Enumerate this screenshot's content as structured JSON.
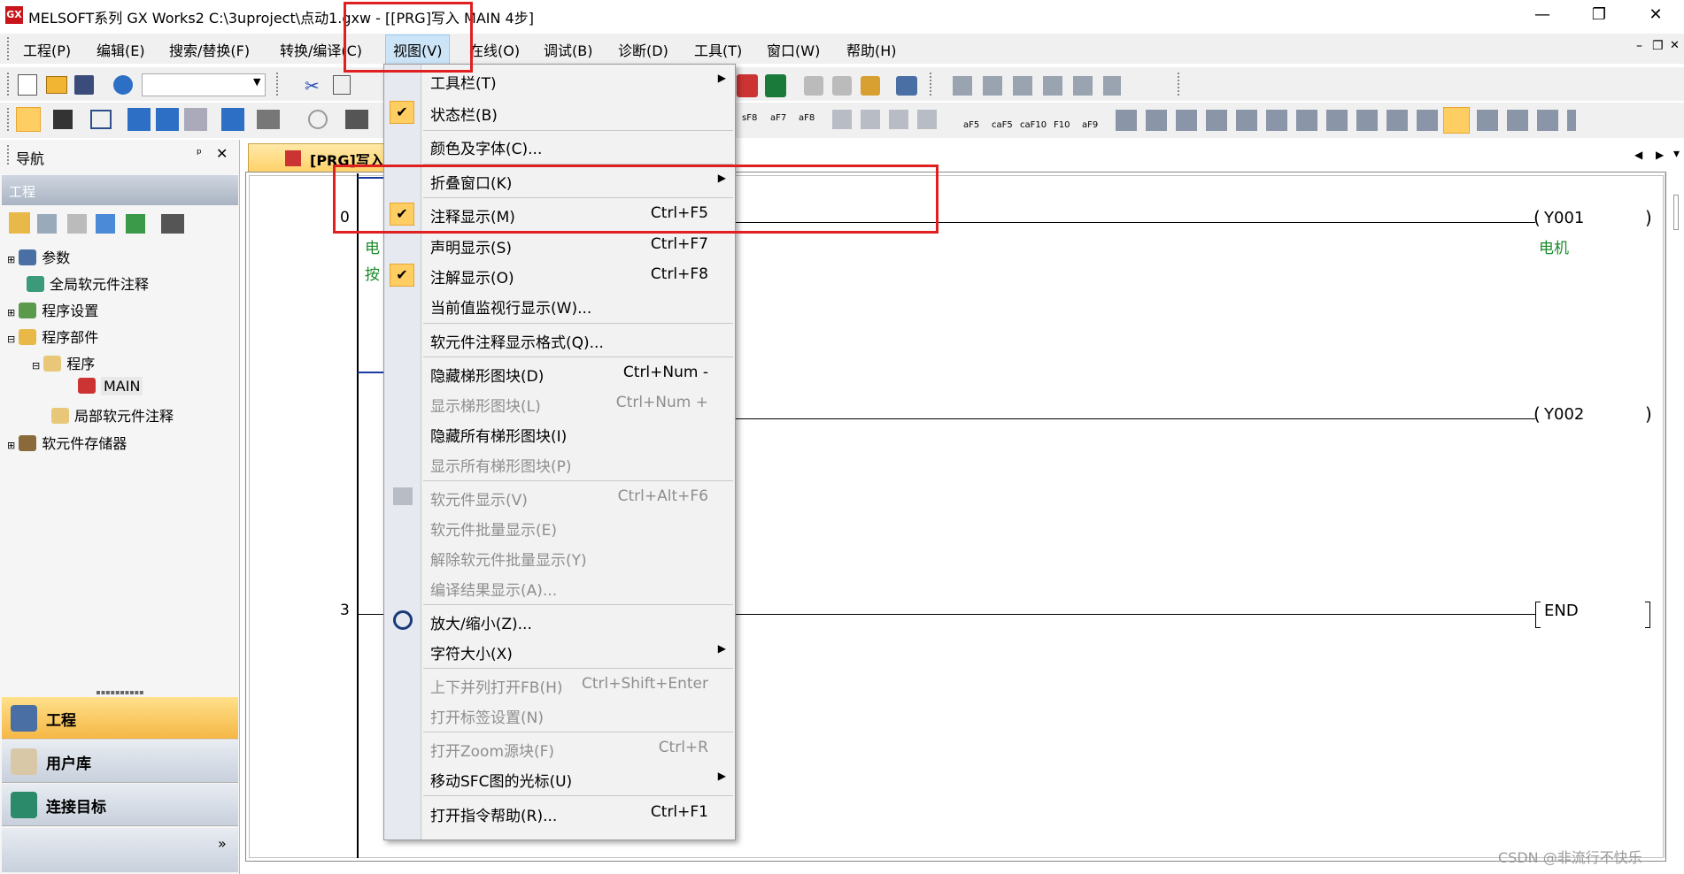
{
  "window": {
    "icon_text": "GX",
    "title": "MELSOFT系列 GX Works2 C:\\3uproject\\点动1.gxw - [[PRG]写入 MAIN 4步]",
    "minimize": "—",
    "restore": "❐",
    "close": "✕"
  },
  "menubar": {
    "items": [
      {
        "label": "工程(P)"
      },
      {
        "label": "编辑(E)"
      },
      {
        "label": "搜索/替换(F)"
      },
      {
        "label": "转换/编译(C)"
      },
      {
        "label": "视图(V)"
      },
      {
        "label": "在线(O)"
      },
      {
        "label": "调试(B)"
      },
      {
        "label": "诊断(D)"
      },
      {
        "label": "工具(T)"
      },
      {
        "label": "窗口(W)"
      },
      {
        "label": "帮助(H)"
      }
    ],
    "mdi_minimize": "–",
    "mdi_restore": "❐",
    "mdi_close": "✕"
  },
  "nav": {
    "title": "导航",
    "pin": "ᵖ",
    "close": "✕",
    "section": "工程",
    "tree": [
      {
        "label": "参数"
      },
      {
        "label": "全局软元件注释"
      },
      {
        "label": "程序设置"
      },
      {
        "label": "程序部件"
      },
      {
        "label": "程序"
      },
      {
        "label": "MAIN"
      },
      {
        "label": "局部软元件注释"
      },
      {
        "label": "软元件存储器"
      }
    ],
    "bottom": [
      {
        "label": "工程"
      },
      {
        "label": "用户库"
      },
      {
        "label": "连接目标"
      }
    ],
    "more": "»"
  },
  "editor": {
    "tab": "[PRG]写入",
    "steps": [
      "0",
      "3"
    ],
    "coils": [
      {
        "name": "Y001",
        "comment": "电机"
      },
      {
        "name": "Y002"
      },
      {
        "name": "END"
      }
    ],
    "contact_comment_1": "电",
    "contact_comment_2": "按",
    "watermark": "CSDN @非流行不快乐",
    "scroll_left": "◀",
    "scroll_right": "▶",
    "scroll_down": "▾"
  },
  "toolbar": {
    "ladder_labels": [
      "sF8",
      "aF7",
      "aF8",
      "aF5",
      "caF5",
      "caF10",
      "F10",
      "aF9"
    ]
  },
  "dropdown": {
    "items": [
      {
        "label": "工具栏(T)",
        "submenu": "▶"
      },
      {
        "label": "状态栏(B)",
        "check": "✔"
      },
      {
        "label": "颜色及字体(C)..."
      },
      {
        "label": "折叠窗口(K)",
        "submenu": "▶"
      },
      {
        "label": "注释显示(M)",
        "shortcut": "Ctrl+F5",
        "check": "✔"
      },
      {
        "label": "声明显示(S)",
        "shortcut": "Ctrl+F7"
      },
      {
        "label": "注解显示(O)",
        "shortcut": "Ctrl+F8",
        "check": "✔"
      },
      {
        "label": "当前值监视行显示(W)..."
      },
      {
        "label": "软元件注释显示格式(Q)..."
      },
      {
        "label": "隐藏梯形图块(D)",
        "shortcut": "Ctrl+Num -"
      },
      {
        "label": "显示梯形图块(L)",
        "shortcut": "Ctrl+Num +"
      },
      {
        "label": "隐藏所有梯形图块(I)"
      },
      {
        "label": "显示所有梯形图块(P)"
      },
      {
        "label": "软元件显示(V)",
        "shortcut": "Ctrl+Alt+F6"
      },
      {
        "label": "软元件批量显示(E)"
      },
      {
        "label": "解除软元件批量显示(Y)"
      },
      {
        "label": "编译结果显示(A)..."
      },
      {
        "label": "放大/缩小(Z)..."
      },
      {
        "label": "字符大小(X)",
        "submenu": "▶"
      },
      {
        "label": "上下并列打开FB(H)",
        "shortcut": "Ctrl+Shift+Enter"
      },
      {
        "label": "打开标签设置(N)"
      },
      {
        "label": "打开Zoom源块(F)",
        "shortcut": "Ctrl+R"
      },
      {
        "label": "移动SFC图的光标(U)",
        "submenu": "▶"
      },
      {
        "label": "打开指令帮助(R)...",
        "shortcut": "Ctrl+F1"
      }
    ]
  },
  "colors": {
    "highlight": "#e02020",
    "nav_active": "#f7c25a",
    "check_bg": "#ffce62"
  }
}
